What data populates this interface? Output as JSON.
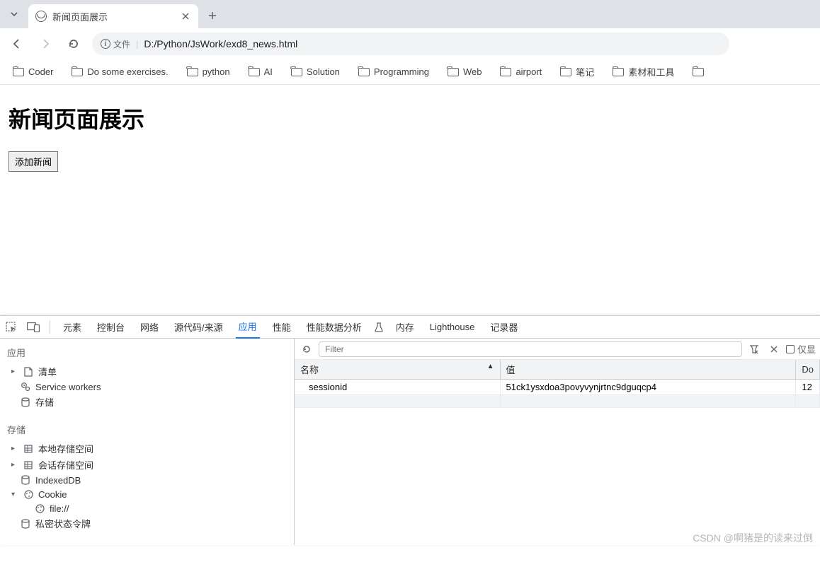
{
  "tab": {
    "title": "新闻页面展示"
  },
  "toolbar": {
    "site_label": "文件",
    "url": "D:/Python/JsWork/exd8_news.html"
  },
  "bookmarks": [
    "Coder",
    "Do some exercises.",
    "python",
    "AI",
    "Solution",
    "Programming",
    "Web",
    "airport",
    "笔记",
    "素材和工具"
  ],
  "page": {
    "heading": "新闻页面展示",
    "add_button": "添加新闻"
  },
  "devtools": {
    "tabs": [
      "元素",
      "控制台",
      "网络",
      "源代码/来源",
      "应用",
      "性能",
      "性能数据分析",
      "内存",
      "Lighthouse",
      "记录器"
    ],
    "active_tab_index": 4,
    "filter_placeholder": "Filter",
    "right_toggle_label": "仅显",
    "sidebar": {
      "app_section": "应用",
      "app_items": [
        "清单",
        "Service workers",
        "存储"
      ],
      "storage_section": "存储",
      "storage_items": [
        "本地存储空间",
        "会话存储空间",
        "IndexedDB",
        "Cookie",
        "file://",
        "私密状态令牌"
      ]
    },
    "table": {
      "columns": [
        "名称",
        "值",
        "Do"
      ],
      "rows": [
        {
          "name": "sessionid",
          "value": "51ck1ysxdoa3povyvynjrtnc9dguqcp4",
          "d": "12"
        }
      ]
    }
  },
  "watermark": "CSDN @啊猪是的读来过倒"
}
